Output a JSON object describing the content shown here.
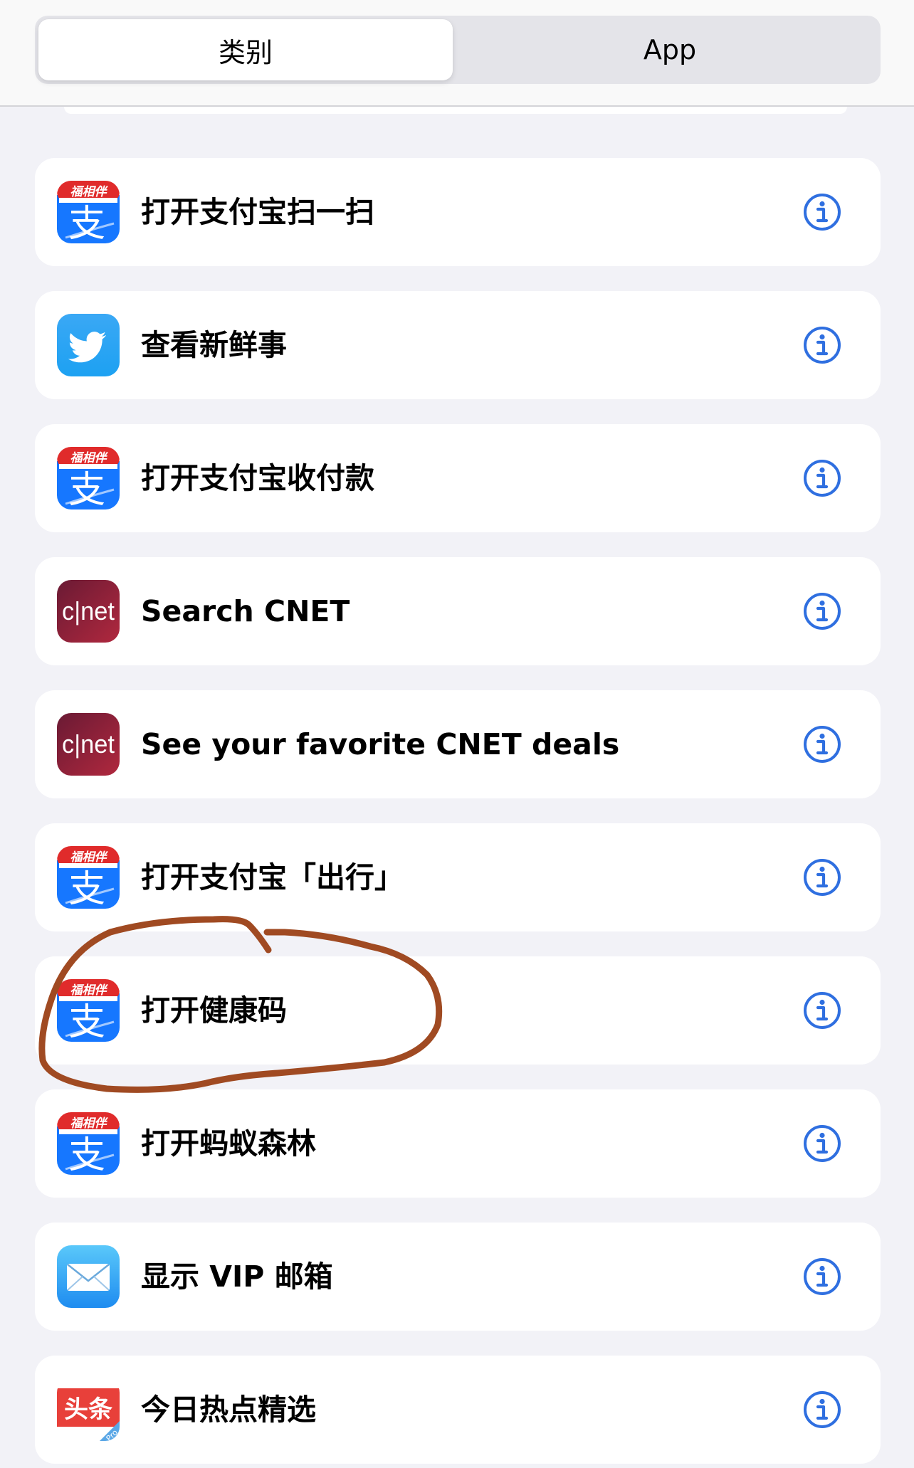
{
  "segmented_control": {
    "segments": [
      "类别",
      "App"
    ],
    "selected": "类别"
  },
  "rows": [
    {
      "icon": "alipay-icon",
      "label": "打开支付宝扫一扫"
    },
    {
      "icon": "twitter-icon",
      "label": "查看新鲜事"
    },
    {
      "icon": "alipay-icon",
      "label": "打开支付宝收付款"
    },
    {
      "icon": "cnet-icon",
      "label": "Search CNET"
    },
    {
      "icon": "cnet-icon",
      "label": "See your favorite CNET deals"
    },
    {
      "icon": "alipay-icon",
      "label": "打开支付宝「出行」"
    },
    {
      "icon": "alipay-icon",
      "label": "打开健康码"
    },
    {
      "icon": "alipay-icon",
      "label": "打开蚂蚁森林"
    },
    {
      "icon": "mail-icon",
      "label": "显示 VIP 邮箱"
    },
    {
      "icon": "toutiao-icon",
      "label": "今日热点精选"
    }
  ],
  "icon_text": {
    "alipay_badge": "福相伴",
    "alipay_char": "支",
    "cnet": "c|net",
    "toutiao": "头条",
    "toutiao_sub": "Pro"
  },
  "colors": {
    "accent": "#2f6fe0",
    "alipay_blue": "#1677ff",
    "alipay_red": "#e02b2b",
    "twitter_blue": "#1da1f2",
    "cnet_red": "#8e1e3a",
    "mail_blue": "#1e8cf0",
    "toutiao_red": "#e8403a",
    "annotation": "#a04a22"
  },
  "annotation": {
    "kind": "hand-drawn circle",
    "target_row_index": 6
  }
}
